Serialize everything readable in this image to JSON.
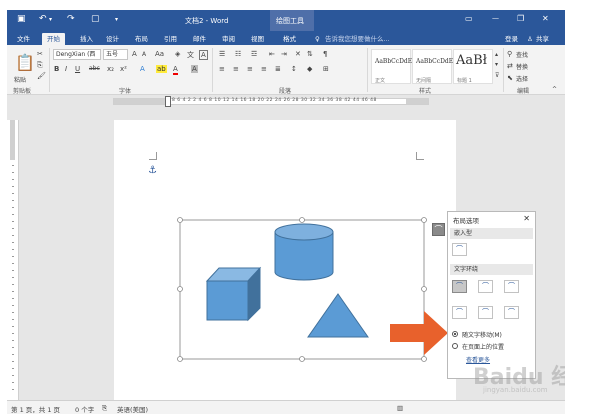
{
  "title_bar": {
    "document_title": "文档2 - Word",
    "contextual_tab": "绘图工具",
    "win_controls": [
      "🗖",
      "—",
      "❐",
      "✕"
    ]
  },
  "tabs": {
    "items": [
      "文件",
      "开始",
      "插入",
      "设计",
      "布局",
      "引用",
      "邮件",
      "审阅",
      "视图",
      "格式"
    ],
    "active": "开始",
    "tell_me": "告诉我您想要做什么...",
    "login": "登录",
    "share": "共享"
  },
  "ribbon": {
    "clipboard": {
      "label": "剪贴板",
      "paste": "粘贴"
    },
    "font": {
      "label": "字体",
      "font_name": "DengXian (西",
      "font_size": "五号",
      "aa": "Aa",
      "a_grow": "A",
      "a_shrink": "A",
      "wen": "文",
      "a_border": "A",
      "bold": "B",
      "italic": "I",
      "underline": "U",
      "strike": "abc",
      "sub": "x₂",
      "sup": "x²",
      "a_effect": "A",
      "a_color": "A",
      "a_shade": "A"
    },
    "paragraph": {
      "label": "段落"
    },
    "styles": {
      "label": "样式",
      "items": [
        {
          "preview": "AaBbCcDdE",
          "name": "正文"
        },
        {
          "preview": "AaBbCcDdE",
          "name": "无间隔"
        },
        {
          "preview": "AaBł",
          "name": "标题 1"
        }
      ]
    },
    "editing": {
      "label": "编辑",
      "find": "查找",
      "replace": "替换",
      "select": "选择"
    }
  },
  "ruler": {
    "ticks": "8  6  4  2     2  4  6  8  10  12  14  16  18  20  22  24  26  28  30  32  34  36  38        42  44  46  48"
  },
  "layout_pane": {
    "title": "布局选项",
    "inline_label": "嵌入型",
    "wrap_label": "文字环绕",
    "move_with_text": "随文字移动(M)",
    "fix_position": "在页面上的位置",
    "see_more": "查看更多"
  },
  "status_bar": {
    "page": "第 1 页，共 1 页",
    "words": "0 个字",
    "language": "英语(美国)"
  },
  "watermark": {
    "text": "Baidu 经验",
    "sub": "jingyan.baidu.com"
  }
}
